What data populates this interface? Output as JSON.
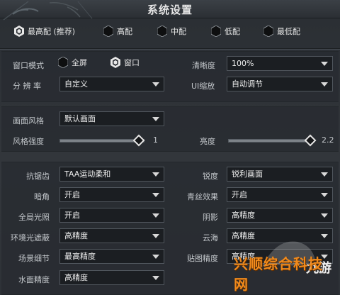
{
  "window": {
    "title": "系统设置"
  },
  "presets": [
    {
      "label": "最高配 (推荐)",
      "selected": true
    },
    {
      "label": "高配",
      "selected": false
    },
    {
      "label": "中配",
      "selected": false
    },
    {
      "label": "低配",
      "selected": false
    },
    {
      "label": "最低配",
      "selected": false
    }
  ],
  "display": {
    "window_mode_label": "窗口模式",
    "fullscreen_label": "全屏",
    "windowed_label": "窗口",
    "brightness_label": "清晰度",
    "brightness_value": "100%",
    "resolution_label": "分 辨 率",
    "resolution_value": "自定义",
    "ui_scale_label": "UI缩放",
    "ui_scale_value": "自动调节"
  },
  "style": {
    "render_style_label": "画面风格",
    "render_style_value": "默认画面",
    "style_strength_label": "风格强度",
    "style_strength_value": "1",
    "style_strength_fraction": 0.95,
    "brightness_label": "亮度",
    "brightness_value": "2.2",
    "brightness_fraction": 0.98
  },
  "graphics": {
    "aa_label": "抗锯齿",
    "aa_value": "TAA运动柔和",
    "sharpen_label": "锐度",
    "sharpen_value": "锐利画面",
    "vignette_label": "暗角",
    "vignette_value": "开启",
    "hair_label": "青丝效果",
    "hair_value": "开启",
    "gi_label": "全局光照",
    "gi_value": "开启",
    "shadow_label": "阴影",
    "shadow_value": "高精度",
    "ao_label": "环境光遮蔽",
    "ao_value": "高精度",
    "cloud_label": "云海",
    "cloud_value": "高精度",
    "scene_label": "场景细节",
    "scene_value": "最高精度",
    "texture_label": "贴图精度",
    "texture_value": "高精度",
    "water_label": "水面精度",
    "water_value": "高精度"
  },
  "watermark": {
    "text": "兴顺综合科技网",
    "brand": "九游"
  }
}
